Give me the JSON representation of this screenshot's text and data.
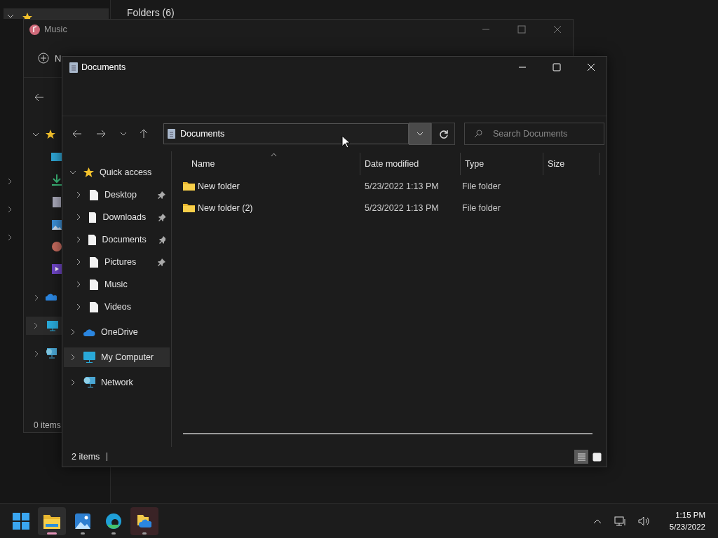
{
  "background_window": {
    "section_header": "Folders (6)"
  },
  "music_window": {
    "title": "Music",
    "new_button": "N",
    "status": "0 items"
  },
  "window": {
    "title": "Documents",
    "address": "Documents",
    "search": {
      "placeholder": "Search Documents"
    },
    "sidebar": [
      {
        "label": "Quick access",
        "kind": "star",
        "expanded": true,
        "selected": false,
        "children": [
          {
            "label": "Desktop",
            "kind": "page",
            "pinned": true,
            "selected": false
          },
          {
            "label": "Downloads",
            "kind": "page",
            "pinned": true,
            "selected": false
          },
          {
            "label": "Documents",
            "kind": "page",
            "pinned": true,
            "selected": false
          },
          {
            "label": "Pictures",
            "kind": "page",
            "pinned": true,
            "selected": false
          },
          {
            "label": "Music",
            "kind": "page",
            "pinned": false,
            "selected": false
          },
          {
            "label": "Videos",
            "kind": "page",
            "pinned": false,
            "selected": false
          }
        ]
      },
      {
        "label": "OneDrive",
        "kind": "cloud",
        "expanded": false,
        "selected": false
      },
      {
        "label": "My Computer",
        "kind": "computer",
        "expanded": false,
        "selected": true
      },
      {
        "label": "Network",
        "kind": "network",
        "expanded": false,
        "selected": false
      }
    ],
    "columns": [
      "Name",
      "Date modified",
      "Type",
      "Size"
    ],
    "rows": [
      {
        "name": "New folder",
        "date": "5/23/2022 1:13 PM",
        "type": "File folder",
        "selected": false
      },
      {
        "name": "New folder (2)",
        "date": "5/23/2022 1:13 PM",
        "type": "File folder",
        "selected": false
      }
    ],
    "status": "2 items",
    "views": [
      {
        "kind": "details",
        "selected": true
      },
      {
        "kind": "tiles",
        "selected": false
      }
    ]
  },
  "taskbar": {
    "apps": [
      {
        "kind": "explorer",
        "active": true
      },
      {
        "kind": "photos",
        "active": false
      },
      {
        "kind": "edge",
        "active": false
      },
      {
        "kind": "files",
        "active": false
      }
    ],
    "time": "1:15 PM",
    "date": "5/23/2022"
  }
}
